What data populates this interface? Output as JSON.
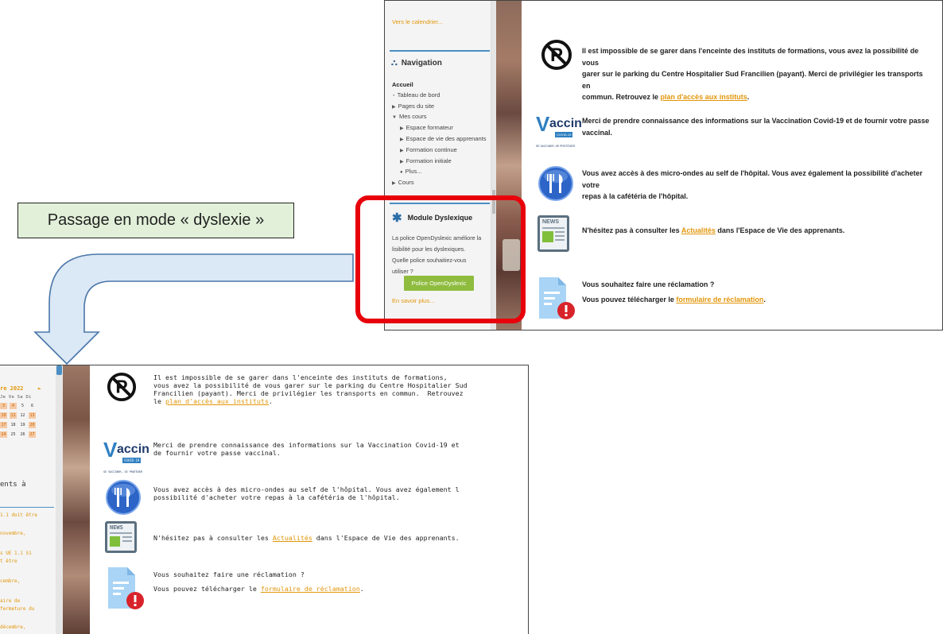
{
  "top": {
    "calendar_link": "Vers le calendrier...",
    "navigation_title": "Navigation",
    "nav_items": [
      {
        "label": "Accueil",
        "level": 0
      },
      {
        "label": "Tableau de bord",
        "level": 0
      },
      {
        "label": "Pages du site",
        "level": 0
      },
      {
        "label": "Mes cours",
        "level": 0
      },
      {
        "label": "Espace formateur",
        "level": 1
      },
      {
        "label": "Espace de vie des apprenants",
        "level": 1
      },
      {
        "label": "Formation continue",
        "level": 1
      },
      {
        "label": "Formation initiale",
        "level": 1
      },
      {
        "label": "Plus...",
        "level": 1
      },
      {
        "label": "Cours",
        "level": 0
      }
    ],
    "dyslexic": {
      "title": "Module Dyslexique",
      "line1": "La police OpenDyslexic améliore la",
      "line2": "lisibilité pour les dyslexiques.",
      "line3": "Quelle police souhaitiez-vous",
      "line4": "utiliser ?",
      "button": "Police OpenDyslexic",
      "learn_more": "En savoir plus..."
    },
    "info": {
      "parking_l1": "Il est impossible de se garer dans l'enceinte des instituts de formations, vous avez la possibilité de vous",
      "parking_l2": "garer sur le parking du Centre Hospitalier Sud Francilien (payant). Merci de privilégier les transports en",
      "parking_l3a": "commun.  Retrouvez le ",
      "parking_link": "plan d'accès aux instituts",
      "parking_l3b": ".",
      "vaccin_l1": "Merci de prendre connaissance des informations sur la Vaccination Covid-19 et de fournir votre passe",
      "vaccin_l2": "vaccinal.",
      "micro_l1": "Vous avez accès à des micro-ondes au self de l'hôpital. Vous avez également la possibilité d'acheter votre",
      "micro_l2": "repas à la cafétéria de l'hôpital.",
      "news_a": "N'hésitez pas à consulter les ",
      "news_link": "Actualités",
      "news_b": " dans l'Espace de Vie des apprenants.",
      "recl_l1": "Vous souhaitez faire une réclamation ?",
      "recl_l2a": "Vous pouvez télécharger le ",
      "recl_link": "formulaire de réclamation",
      "recl_l2b": "."
    },
    "icons": {
      "vaccin_word": "accin",
      "vaccin_v": "V",
      "vaccin_badge": "COVID-19",
      "vaccin_sub": "SE VACCINER, SE PROTÉGER",
      "news_label": "NEWS"
    }
  },
  "callout": "Passage en mode « dyslexie »",
  "bottom": {
    "calendar": {
      "month": "re 2022",
      "next_arrow": "►",
      "days_header": "Je Ve Sa Di",
      "days_row1": [
        "3",
        "4",
        "5",
        "6"
      ],
      "days_row2": [
        "10",
        "11",
        "12",
        "13"
      ],
      "days_row3": [
        "17",
        "18",
        "19",
        "20"
      ],
      "days_row4": [
        "24",
        "25",
        "26",
        "27"
      ]
    },
    "events_title": "ents à",
    "events": [
      "1.1 doit être",
      "novembre,",
      "s UE 1.1 S1",
      "t être",
      "cembre,",
      "aire de",
      "fermeture du",
      "décembre,"
    ],
    "info": {
      "p1": "Il est impossible de se garer dans l'enceinte des instituts de formations,",
      "p2": "vous avez la possibilité de vous garer sur le parking du Centre Hospitalier Sud",
      "p3": "Francilien (payant). Merci de privilégier les transports en commun.  Retrouvez",
      "p4a": "le ",
      "p4link": "plan d'accès aux instituts",
      "p4b": ".",
      "v1": "Merci de prendre connaissance des informations sur la Vaccination Covid-19 et",
      "v2": "de fournir votre passe vaccinal.",
      "m1": "Vous avez accès à des micro-ondes au self de l'hôpital. Vous avez également l",
      "m2": "possibilité d'acheter votre repas à la cafétéria de l'hôpital.",
      "n_a": "N'hésitez pas à consulter les ",
      "n_link": "Actualités",
      "n_b": " dans l'Espace de Vie des apprenants.",
      "r1": "Vous souhaitez faire une réclamation ?",
      "r2a": "Vous pouvez télécharger le ",
      "r2link": "formulaire de réclamation",
      "r2b": "."
    }
  },
  "colors": {
    "link_orange": "#e2960a",
    "button_green": "#8fbc3f",
    "highlight_red": "#e8000b",
    "callout_bg": "#e2f0d9",
    "arrow_fill": "#dbe8f5",
    "arrow_stroke": "#4a76a8",
    "accent_blue": "#4a8fc4"
  }
}
